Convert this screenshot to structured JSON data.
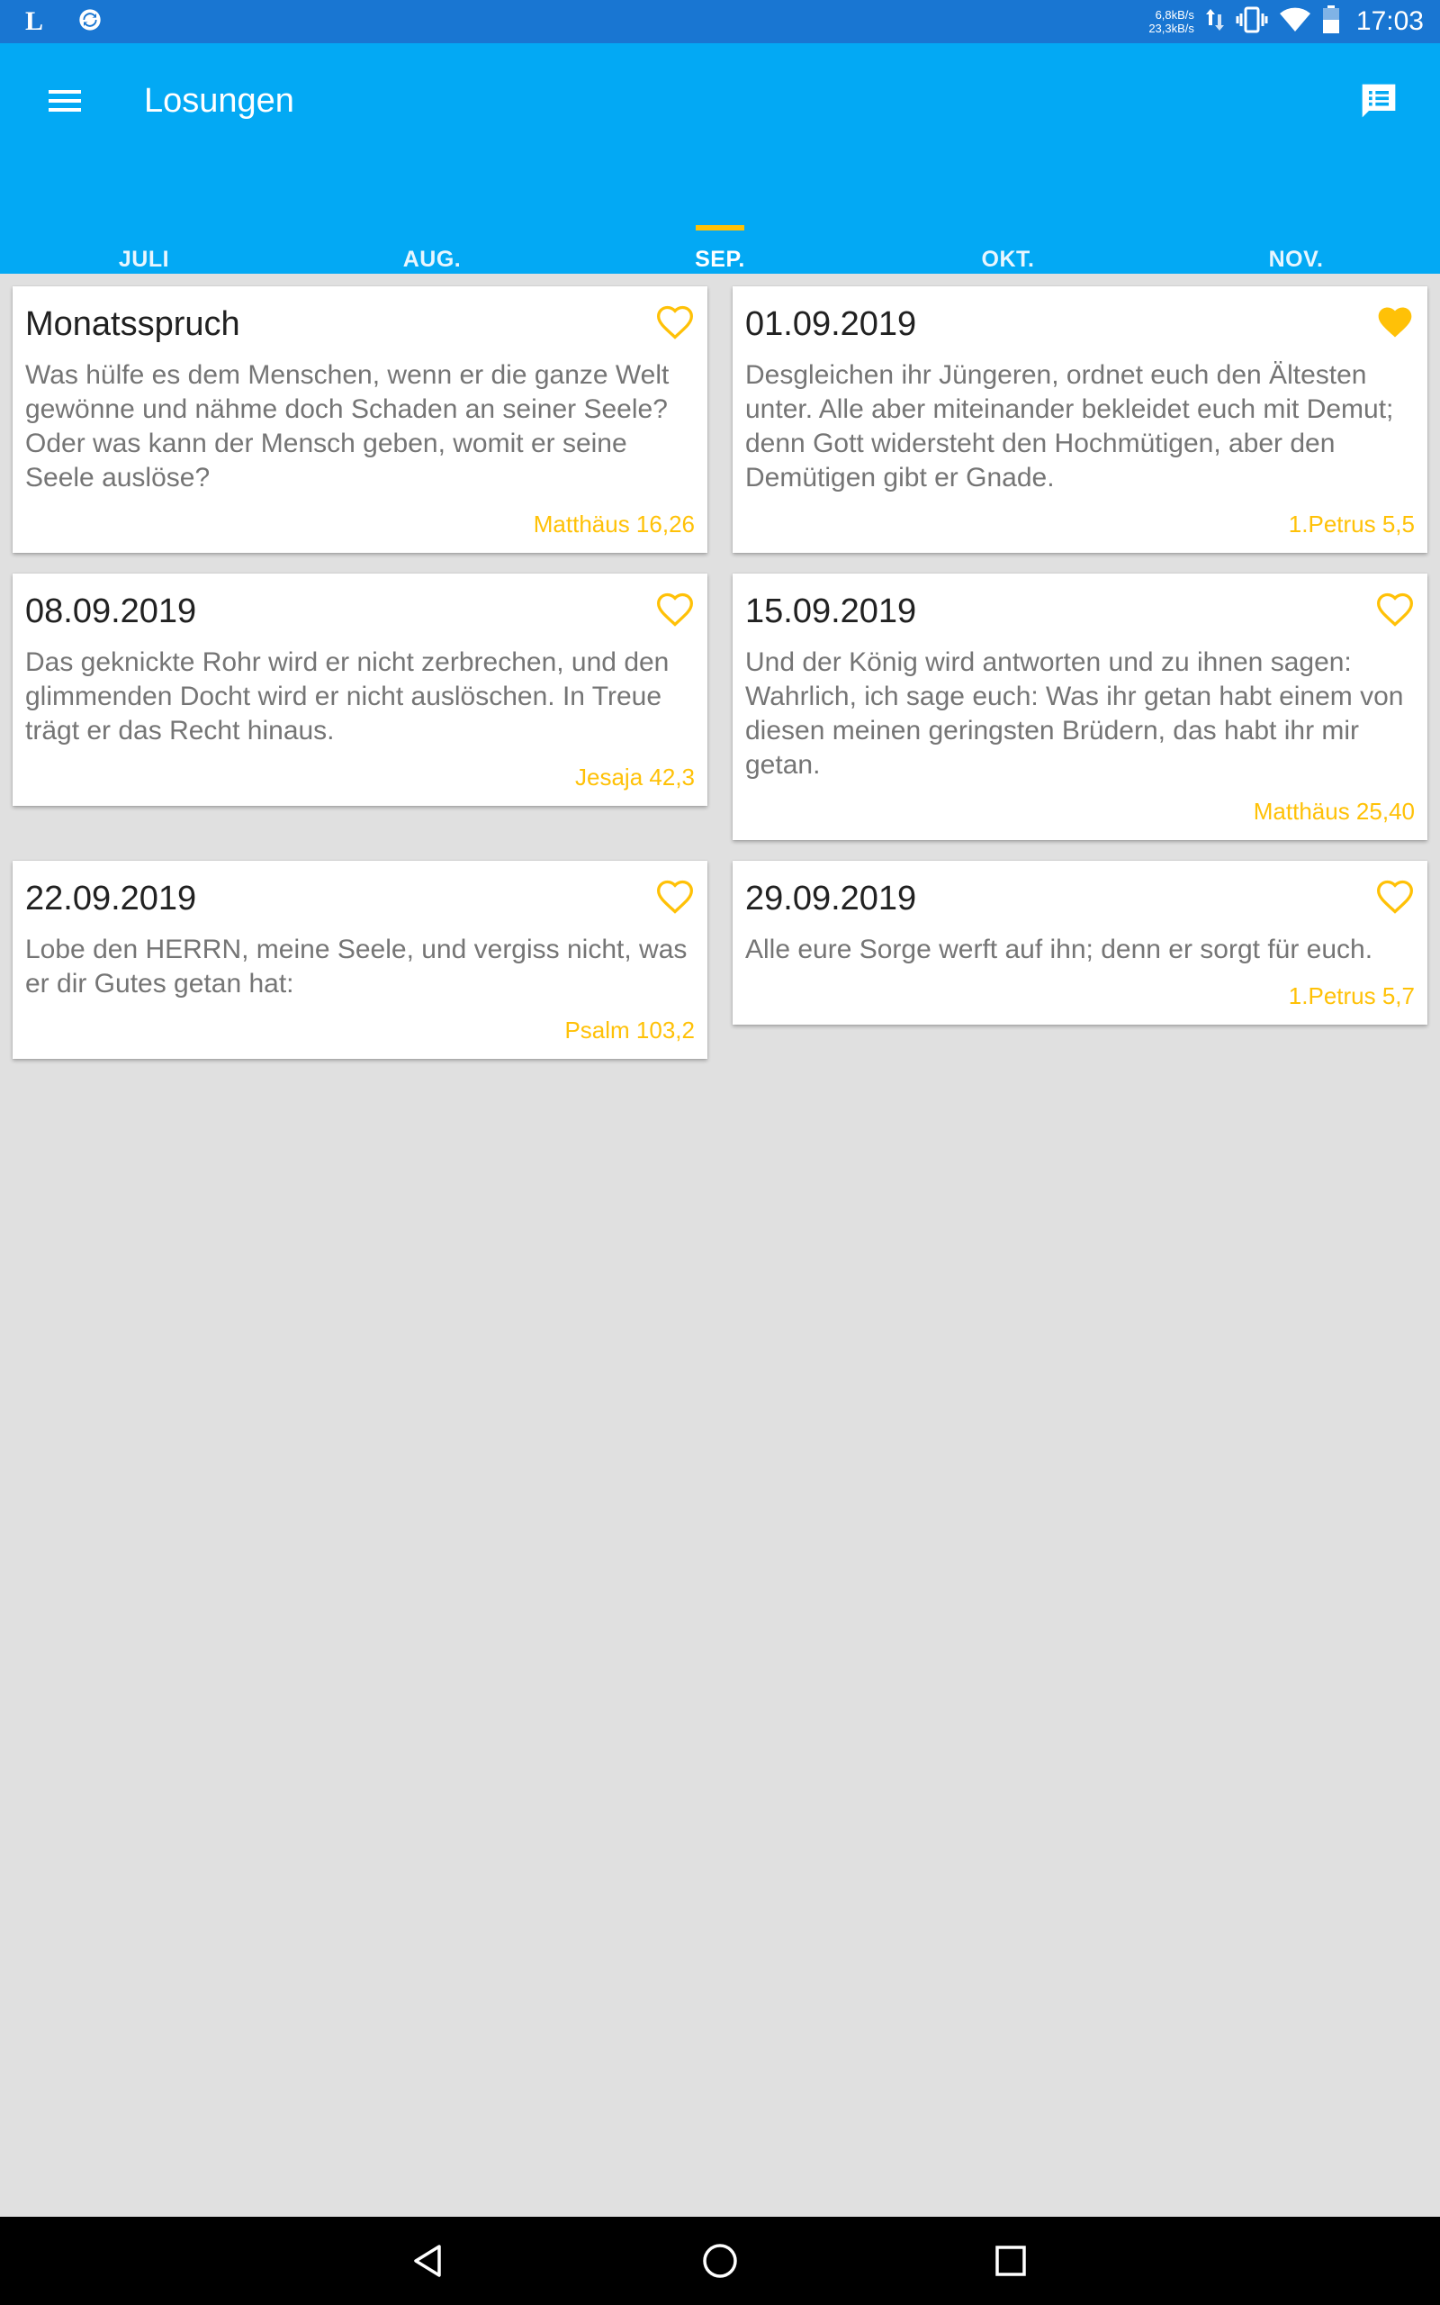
{
  "status_bar": {
    "left_letter": "L",
    "net_up": "6,8kB/s",
    "net_down": "23,3kB/s",
    "time": "17:03",
    "icons": [
      "sync-icon",
      "data-arrows-icon",
      "vibrate-icon",
      "wifi-icon",
      "battery-icon"
    ]
  },
  "app_bar": {
    "title": "Losungen",
    "menu_icon": "hamburger-menu-icon",
    "action_icon": "chat-list-icon"
  },
  "tabs": [
    {
      "label": "JULI",
      "active": false
    },
    {
      "label": "AUG.",
      "active": false
    },
    {
      "label": "SEP.",
      "active": true
    },
    {
      "label": "OKT.",
      "active": false
    },
    {
      "label": "NOV.",
      "active": false
    }
  ],
  "cards": [
    {
      "title": "Monatsspruch",
      "text": "Was hülfe es dem Menschen, wenn er die ganze Welt gewönne und nähme doch Schaden an seiner Seele? Oder was kann der Mensch geben, womit er seine Seele auslöse?",
      "reference": "Matthäus 16,26",
      "favorite": false
    },
    {
      "title": "01.09.2019",
      "text": "Desgleichen ihr Jüngeren, ordnet euch den Ältesten unter. Alle aber miteinander bekleidet euch mit Demut; denn Gott widersteht den Hochmütigen, aber den Demütigen gibt er Gnade.",
      "reference": "1.Petrus 5,5",
      "favorite": true
    },
    {
      "title": "08.09.2019",
      "text": "Das geknickte Rohr wird er nicht zerbrechen, und den glimmenden Docht wird er nicht auslöschen. In Treue trägt er das Recht hinaus.",
      "reference": "Jesaja 42,3",
      "favorite": false
    },
    {
      "title": "15.09.2019",
      "text": "Und der König wird antworten und zu ihnen sagen: Wahrlich, ich sage euch: Was ihr getan habt einem von diesen meinen geringsten Brüdern, das habt ihr mir getan.",
      "reference": "Matthäus 25,40",
      "favorite": false
    },
    {
      "title": "22.09.2019",
      "text": "Lobe den HERRN, meine Seele, und vergiss nicht, was er dir Gutes getan hat:",
      "reference": "Psalm 103,2",
      "favorite": false
    },
    {
      "title": "29.09.2019",
      "text": "Alle eure Sorge werft auf ihn; denn er sorgt für euch.",
      "reference": "1.Petrus 5,7",
      "favorite": false
    }
  ],
  "colors": {
    "status_bar": "#1976d2",
    "app_bar": "#03a9f4",
    "accent": "#ffc107",
    "background": "#e0e0e0"
  },
  "nav_bar": {
    "icons": [
      "back-icon",
      "home-icon",
      "recents-icon"
    ]
  }
}
